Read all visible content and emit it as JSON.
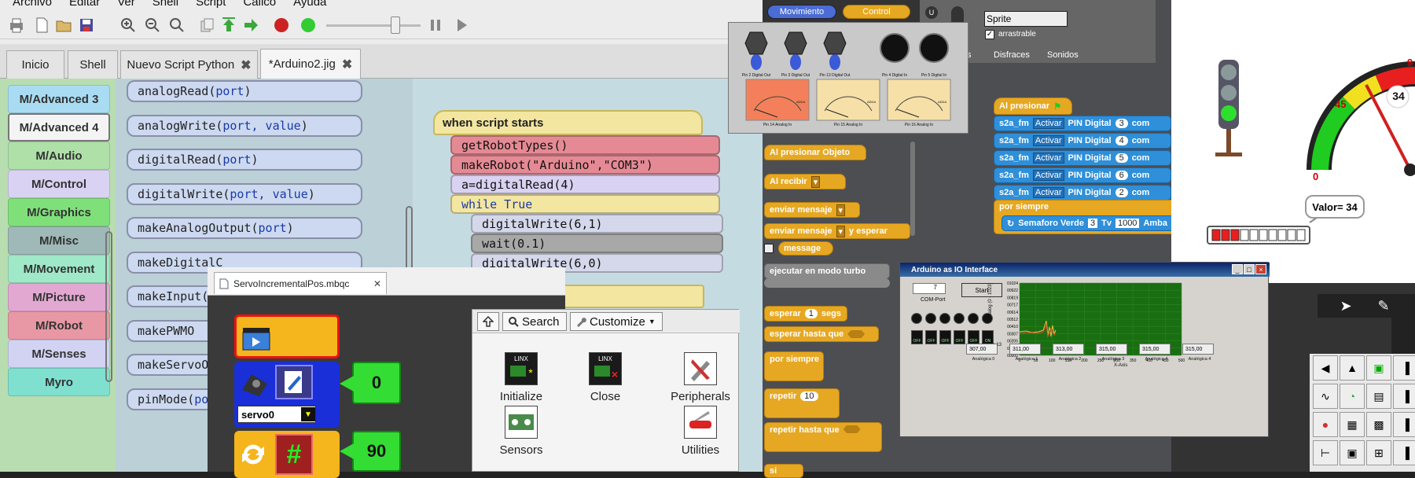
{
  "menu": [
    "Archivo",
    "Editar",
    "Ver",
    "Shell",
    "Script",
    "Cálico",
    "Ayuda"
  ],
  "tabs": [
    {
      "label": "Inicio",
      "closable": false
    },
    {
      "label": "Shell",
      "closable": false
    },
    {
      "label": "Nuevo Script Python",
      "closable": true
    },
    {
      "label": "*Arduino2.jig",
      "closable": true
    }
  ],
  "categories": [
    {
      "label": "M/Advanced 3",
      "color": "#a9dcf2"
    },
    {
      "label": "M/Advanced 4",
      "color": "#f4f4f4"
    },
    {
      "label": "M/Audio",
      "color": "#aee0a8"
    },
    {
      "label": "M/Control",
      "color": "#d9d2f2"
    },
    {
      "label": "M/Graphics",
      "color": "#7fe07a"
    },
    {
      "label": "M/Misc",
      "color": "#9fb8b8"
    },
    {
      "label": "M/Movement",
      "color": "#9fe8c8"
    },
    {
      "label": "M/Picture",
      "color": "#e2a8d2"
    },
    {
      "label": "M/Robot",
      "color": "#e898a4"
    },
    {
      "label": "M/Senses",
      "color": "#d2d2f2"
    },
    {
      "label": "Myro",
      "color": "#7fe0d0"
    }
  ],
  "palette": [
    {
      "name": "analogRead",
      "args": "port"
    },
    {
      "name": "analogWrite",
      "args": "port, value"
    },
    {
      "name": "digitalRead",
      "args": "port"
    },
    {
      "name": "digitalWrite",
      "args": "port, value"
    },
    {
      "name": "makeAnalogOutput",
      "args": "port"
    },
    {
      "name": "makeDigitalC",
      "args": ""
    },
    {
      "name": "makeInput",
      "args": "p"
    },
    {
      "name": "makePWMO",
      "args": ""
    },
    {
      "name": "makeServoO",
      "args": ""
    },
    {
      "name": "pinMode",
      "args": "por"
    }
  ],
  "script": {
    "hat": "when script starts",
    "lines": [
      {
        "text": "getRobotTypes()",
        "color": "#e58a94"
      },
      {
        "text": "makeRobot(\"Arduino\",\"COM3\")",
        "color": "#e58a94"
      },
      {
        "text": "a=digitalRead(4)",
        "color": "#d9d2f2"
      },
      {
        "text": "while True",
        "color": "#f3e6a0"
      },
      {
        "text": "digitalWrite(6,1)",
        "color": "#d4d8ea"
      },
      {
        "text": "wait(0.1)",
        "color": "#a8a8a8"
      },
      {
        "text": "digitalWrite(6,0)",
        "color": "#d4d8ea"
      }
    ]
  },
  "servo_window": {
    "tab_label": "ServoIncrementalPos.mbqc",
    "device": "servo0",
    "value_top": "0",
    "value_bottom": "90"
  },
  "linx": {
    "search": "Search",
    "customize": "Customize",
    "items": [
      "Initialize",
      "Close",
      "Peripherals",
      "Sensors",
      "Utilities"
    ]
  },
  "scratch": {
    "categories": [
      "Movimiento",
      "Control"
    ],
    "sprite_name": "Sprite",
    "draggable": "arrastrable",
    "tabs": [
      "s",
      "Disfraces",
      "Sonidos"
    ],
    "hat": "Al presionar",
    "pin_rows": [
      {
        "prefix": "s2a_fm",
        "action": "Activar",
        "label": "PIN Digital",
        "pin": "3",
        "suffix": "com"
      },
      {
        "prefix": "s2a_fm",
        "action": "Activar",
        "label": "PIN Digital",
        "pin": "4",
        "suffix": "com"
      },
      {
        "prefix": "s2a_fm",
        "action": "Activar",
        "label": "PIN Digital",
        "pin": "5",
        "suffix": "com"
      },
      {
        "prefix": "s2a_fm",
        "action": "Activar",
        "label": "PIN Digital",
        "pin": "6",
        "suffix": "com"
      },
      {
        "prefix": "s2a_fm",
        "action": "Activar",
        "label": "PIN Digital",
        "pin": "2",
        "suffix": "com"
      }
    ],
    "forever": "por siempre",
    "semaforo_call": {
      "label": "Semaforo Verde",
      "n": "3",
      "tv": "Tv",
      "tv_val": "1000",
      "tail": "Amba"
    },
    "palette": {
      "al_presionar_objeto": "Al presionar Objeto",
      "al_recibir": "Al recibir",
      "enviar_mensaje": "enviar mensaje",
      "enviar_y_esperar_a": "enviar mensaje",
      "enviar_y_esperar_b": "y esperar",
      "message": "message",
      "turbo": "ejecutar en modo turbo",
      "esperar_a": "esperar",
      "esperar_val": "1",
      "esperar_b": "segs",
      "esperar_hasta": "esperar hasta que",
      "por_siempre": "por siempre",
      "repetir": "repetir",
      "repetir_val": "10",
      "repetir_hasta": "repetir hasta que",
      "si": "si"
    }
  },
  "gauges_panel": {
    "knob_labels": [
      "Pin 2 Digital Out",
      "Pin 3 Digital Out",
      "Pin 13 Digital Out"
    ],
    "led_labels": [
      "Pin 4 Digital In",
      "Pin 5 Digital In"
    ],
    "meter_labels": [
      "Pin 14 Analog In",
      "Pin 15 Analog In",
      "Pin 16 Analog In"
    ],
    "meter_unit": "ADDA"
  },
  "arduino_io": {
    "title": "Arduino as IO Interface",
    "com_value": "7",
    "com_label": "COM-Port",
    "start": "Start",
    "salida": "Salida 13",
    "toggle_off": "OFF",
    "toggle_on": "ON",
    "y_ticks": [
      "01024",
      "00922",
      "00819",
      "00717",
      "00614",
      "00512",
      "00410",
      "00307",
      "00205",
      "00102",
      "00000"
    ],
    "x_ticks": [
      "0",
      "50",
      "100",
      "150",
      "200",
      "250",
      "300",
      "350",
      "400",
      "450",
      "500"
    ],
    "x_axis": "X-Axis",
    "y_axis": "Analog (0 - 1023)",
    "analog_values": [
      "307,00",
      "311,00",
      "313,00",
      "315,00",
      "315,00",
      "315,00"
    ],
    "analog_labels": [
      "Analógica 0",
      "Analógica 1",
      "Analógica 2",
      "Analógica 3",
      "Analógica 4",
      "Analógica 4"
    ]
  },
  "semaforo_panel": {
    "gauge_labels": [
      "0",
      "45",
      "9"
    ],
    "gauge_value": "34",
    "valor_text": "Valor= 34",
    "bar_fraction": 0.34
  },
  "colors": {
    "scratch_control": "#e6a822",
    "scratch_blue": "#2f8fd8",
    "lcd_green": "#33dd33",
    "chart_bg": "#1a6e12"
  }
}
